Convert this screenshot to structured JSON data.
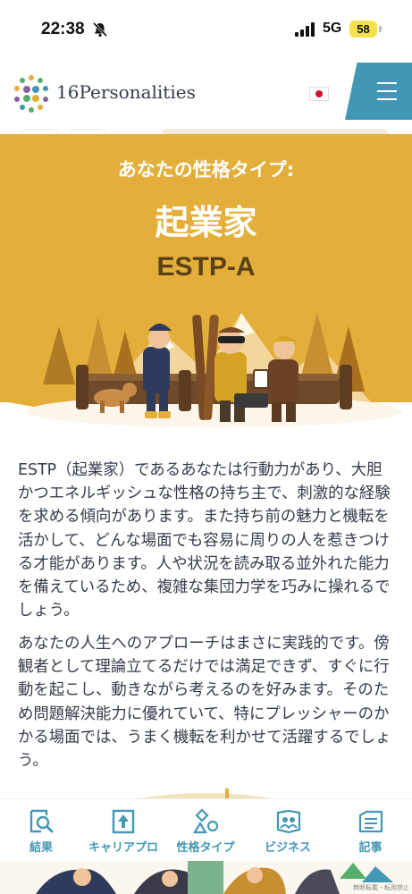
{
  "status_bar": {
    "time": "22:38",
    "network": "5G",
    "battery": "58"
  },
  "header": {
    "brand": "16Personalities"
  },
  "hero": {
    "label": "あなたの性格タイプ:",
    "title": "起業家",
    "code": "ESTP-A"
  },
  "body": {
    "paragraph1": "ESTP（起業家）であるあなたは行動力があり、大胆かつエネルギッシュな性格の持ち主で、刺激的な経験を求める傾向があります。また持ち前の魅力と機転を活かして、どんな場面でも容易に周りの人を惹きつける才能があります。人や状況を読み取る並外れた能力を備えているため、複雑な集団力学を巧みに操れるでしょう。",
    "paragraph2": "あなたの人生へのアプローチはまさに実践的です。傍観者として理論立てるだけでは満足できず、すぐに行動を起こし、動きながら考えるのを好みます。そのため問題解決能力に優れていて、特にプレッシャーのかかる場面では、うまく機転を利かせて活躍するでしょう。"
  },
  "tabs": [
    {
      "label": "結果",
      "icon": "search-results-icon"
    },
    {
      "label": "キャリアプロ",
      "icon": "career-icon"
    },
    {
      "label": "性格タイプ",
      "icon": "personality-types-icon"
    },
    {
      "label": "ビジネス",
      "icon": "business-icon"
    },
    {
      "label": "記事",
      "icon": "articles-icon"
    }
  ],
  "footer_note": "無断転載・転用禁止",
  "colors": {
    "hero": "#e4ae3a",
    "accent": "#4298b4",
    "text": "#343c4b"
  }
}
